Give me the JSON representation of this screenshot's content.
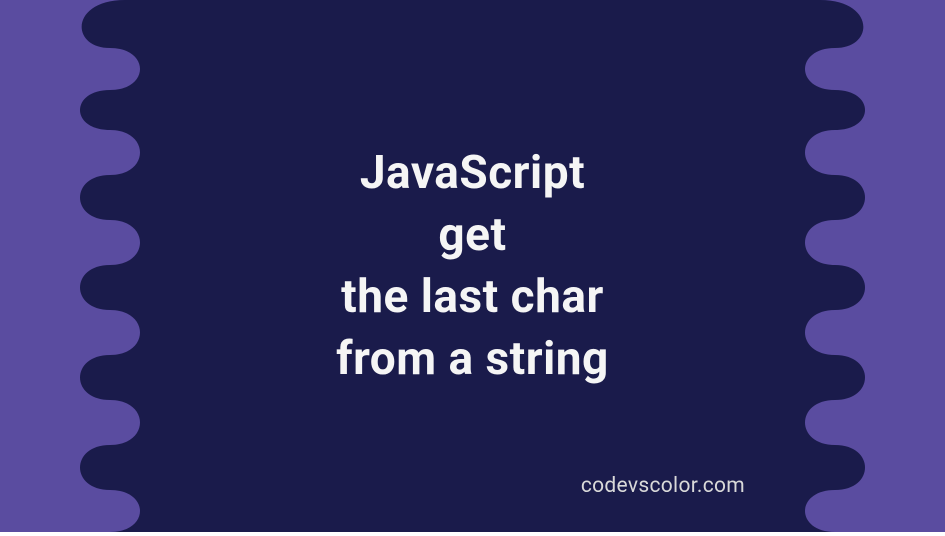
{
  "colors": {
    "background": "#1a1b4b",
    "blob": "#5a4ca0",
    "text": "#f5f5f5",
    "watermark": "#d9d9d9"
  },
  "title": {
    "line1": "JavaScript",
    "line2": "get",
    "line3": "the last char",
    "line4": "from a string"
  },
  "watermark": "codevscolor.com"
}
